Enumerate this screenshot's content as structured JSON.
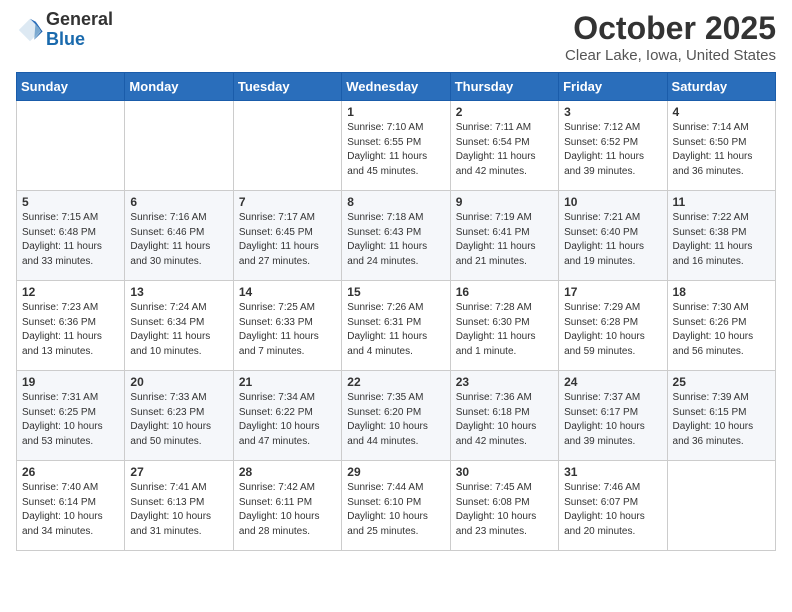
{
  "logo": {
    "general": "General",
    "blue": "Blue"
  },
  "header": {
    "month": "October 2025",
    "location": "Clear Lake, Iowa, United States"
  },
  "days_of_week": [
    "Sunday",
    "Monday",
    "Tuesday",
    "Wednesday",
    "Thursday",
    "Friday",
    "Saturday"
  ],
  "weeks": [
    [
      {
        "day": "",
        "info": ""
      },
      {
        "day": "",
        "info": ""
      },
      {
        "day": "",
        "info": ""
      },
      {
        "day": "1",
        "info": "Sunrise: 7:10 AM\nSunset: 6:55 PM\nDaylight: 11 hours\nand 45 minutes."
      },
      {
        "day": "2",
        "info": "Sunrise: 7:11 AM\nSunset: 6:54 PM\nDaylight: 11 hours\nand 42 minutes."
      },
      {
        "day": "3",
        "info": "Sunrise: 7:12 AM\nSunset: 6:52 PM\nDaylight: 11 hours\nand 39 minutes."
      },
      {
        "day": "4",
        "info": "Sunrise: 7:14 AM\nSunset: 6:50 PM\nDaylight: 11 hours\nand 36 minutes."
      }
    ],
    [
      {
        "day": "5",
        "info": "Sunrise: 7:15 AM\nSunset: 6:48 PM\nDaylight: 11 hours\nand 33 minutes."
      },
      {
        "day": "6",
        "info": "Sunrise: 7:16 AM\nSunset: 6:46 PM\nDaylight: 11 hours\nand 30 minutes."
      },
      {
        "day": "7",
        "info": "Sunrise: 7:17 AM\nSunset: 6:45 PM\nDaylight: 11 hours\nand 27 minutes."
      },
      {
        "day": "8",
        "info": "Sunrise: 7:18 AM\nSunset: 6:43 PM\nDaylight: 11 hours\nand 24 minutes."
      },
      {
        "day": "9",
        "info": "Sunrise: 7:19 AM\nSunset: 6:41 PM\nDaylight: 11 hours\nand 21 minutes."
      },
      {
        "day": "10",
        "info": "Sunrise: 7:21 AM\nSunset: 6:40 PM\nDaylight: 11 hours\nand 19 minutes."
      },
      {
        "day": "11",
        "info": "Sunrise: 7:22 AM\nSunset: 6:38 PM\nDaylight: 11 hours\nand 16 minutes."
      }
    ],
    [
      {
        "day": "12",
        "info": "Sunrise: 7:23 AM\nSunset: 6:36 PM\nDaylight: 11 hours\nand 13 minutes."
      },
      {
        "day": "13",
        "info": "Sunrise: 7:24 AM\nSunset: 6:34 PM\nDaylight: 11 hours\nand 10 minutes."
      },
      {
        "day": "14",
        "info": "Sunrise: 7:25 AM\nSunset: 6:33 PM\nDaylight: 11 hours\nand 7 minutes."
      },
      {
        "day": "15",
        "info": "Sunrise: 7:26 AM\nSunset: 6:31 PM\nDaylight: 11 hours\nand 4 minutes."
      },
      {
        "day": "16",
        "info": "Sunrise: 7:28 AM\nSunset: 6:30 PM\nDaylight: 11 hours\nand 1 minute."
      },
      {
        "day": "17",
        "info": "Sunrise: 7:29 AM\nSunset: 6:28 PM\nDaylight: 10 hours\nand 59 minutes."
      },
      {
        "day": "18",
        "info": "Sunrise: 7:30 AM\nSunset: 6:26 PM\nDaylight: 10 hours\nand 56 minutes."
      }
    ],
    [
      {
        "day": "19",
        "info": "Sunrise: 7:31 AM\nSunset: 6:25 PM\nDaylight: 10 hours\nand 53 minutes."
      },
      {
        "day": "20",
        "info": "Sunrise: 7:33 AM\nSunset: 6:23 PM\nDaylight: 10 hours\nand 50 minutes."
      },
      {
        "day": "21",
        "info": "Sunrise: 7:34 AM\nSunset: 6:22 PM\nDaylight: 10 hours\nand 47 minutes."
      },
      {
        "day": "22",
        "info": "Sunrise: 7:35 AM\nSunset: 6:20 PM\nDaylight: 10 hours\nand 44 minutes."
      },
      {
        "day": "23",
        "info": "Sunrise: 7:36 AM\nSunset: 6:18 PM\nDaylight: 10 hours\nand 42 minutes."
      },
      {
        "day": "24",
        "info": "Sunrise: 7:37 AM\nSunset: 6:17 PM\nDaylight: 10 hours\nand 39 minutes."
      },
      {
        "day": "25",
        "info": "Sunrise: 7:39 AM\nSunset: 6:15 PM\nDaylight: 10 hours\nand 36 minutes."
      }
    ],
    [
      {
        "day": "26",
        "info": "Sunrise: 7:40 AM\nSunset: 6:14 PM\nDaylight: 10 hours\nand 34 minutes."
      },
      {
        "day": "27",
        "info": "Sunrise: 7:41 AM\nSunset: 6:13 PM\nDaylight: 10 hours\nand 31 minutes."
      },
      {
        "day": "28",
        "info": "Sunrise: 7:42 AM\nSunset: 6:11 PM\nDaylight: 10 hours\nand 28 minutes."
      },
      {
        "day": "29",
        "info": "Sunrise: 7:44 AM\nSunset: 6:10 PM\nDaylight: 10 hours\nand 25 minutes."
      },
      {
        "day": "30",
        "info": "Sunrise: 7:45 AM\nSunset: 6:08 PM\nDaylight: 10 hours\nand 23 minutes."
      },
      {
        "day": "31",
        "info": "Sunrise: 7:46 AM\nSunset: 6:07 PM\nDaylight: 10 hours\nand 20 minutes."
      },
      {
        "day": "",
        "info": ""
      }
    ]
  ]
}
